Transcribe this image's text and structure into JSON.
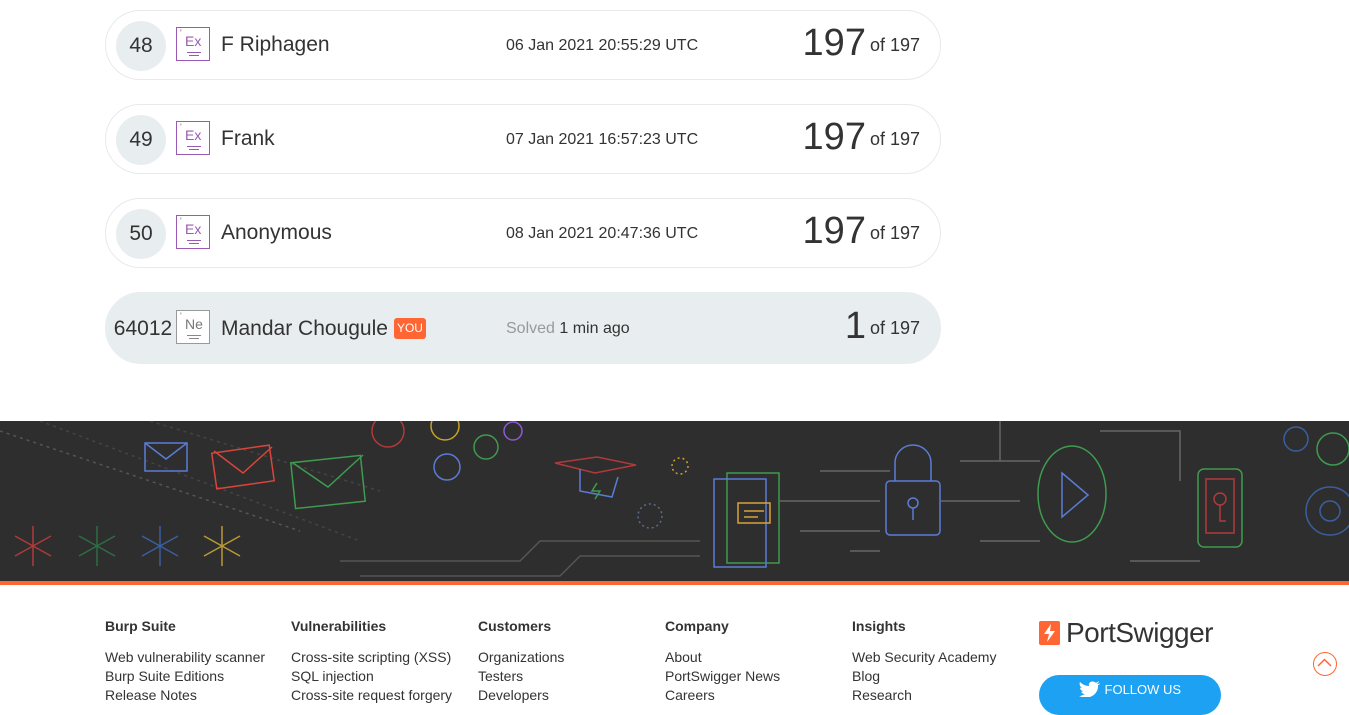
{
  "leaderboard": {
    "rows": [
      {
        "rank": "48",
        "badge": "Ex",
        "name": "F Riphagen",
        "date": "06 Jan 2021 20:55:29 UTC",
        "score": "197",
        "of": "of 197"
      },
      {
        "rank": "49",
        "badge": "Ex",
        "name": "Frank",
        "date": "07 Jan 2021 16:57:23 UTC",
        "score": "197",
        "of": "of 197"
      },
      {
        "rank": "50",
        "badge": "Ex",
        "name": "Anonymous",
        "date": "08 Jan 2021 20:47:36 UTC",
        "score": "197",
        "of": "of 197"
      }
    ],
    "current_user": {
      "rank": "64012",
      "badge": "Ne",
      "name": "Mandar Chougule",
      "you_label": "YOU",
      "solved_label": "Solved",
      "solved_time": "1 min ago",
      "score": "1",
      "of": "of 197"
    }
  },
  "footer": {
    "columns": [
      {
        "heading": "Burp Suite",
        "links": [
          "Web vulnerability scanner",
          "Burp Suite Editions",
          "Release Notes"
        ]
      },
      {
        "heading": "Vulnerabilities",
        "links": [
          "Cross-site scripting (XSS)",
          "SQL injection",
          "Cross-site request forgery"
        ]
      },
      {
        "heading": "Customers",
        "links": [
          "Organizations",
          "Testers",
          "Developers"
        ]
      },
      {
        "heading": "Company",
        "links": [
          "About",
          "PortSwigger News",
          "Careers"
        ]
      },
      {
        "heading": "Insights",
        "links": [
          "Web Security Academy",
          "Blog",
          "Research"
        ]
      }
    ],
    "logo_text": "PortSwigger",
    "follow_label": "FOLLOW US"
  },
  "colors": {
    "accent": "#ff6633",
    "expert_badge": "#9b59b6",
    "twitter": "#1da1f2",
    "banner_bg": "#2e2e2e"
  },
  "icons": {
    "banner": "academy-illustration",
    "scroll_top": "chevron-up-icon",
    "twitter": "twitter-bird-icon"
  }
}
